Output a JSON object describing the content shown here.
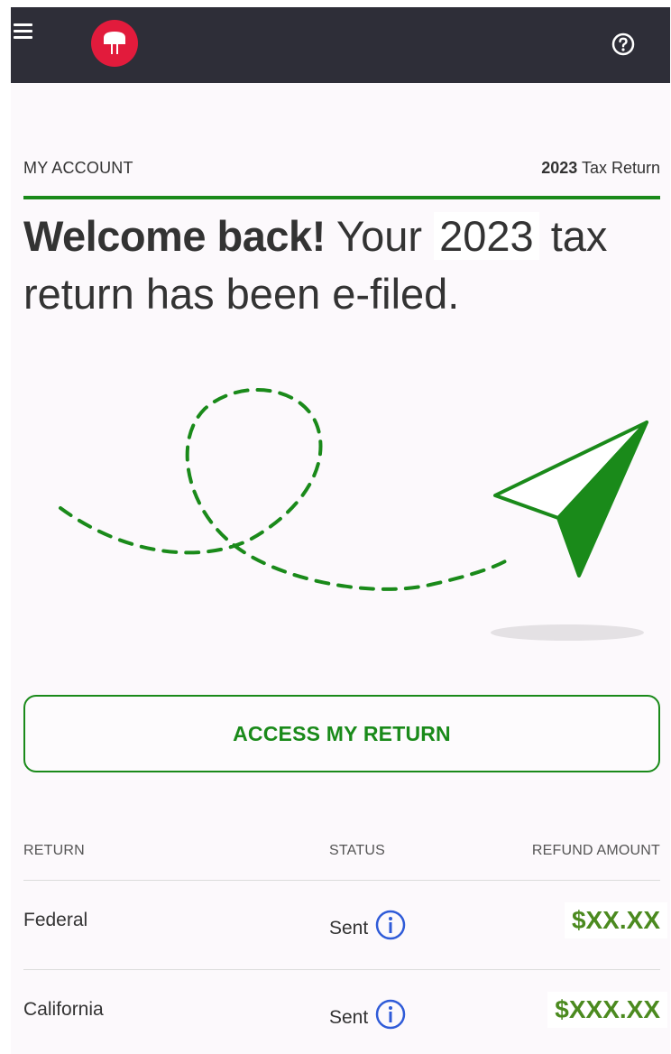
{
  "header": {
    "menu_icon": "hamburger-menu-icon",
    "logo_icon": "helmet-logo-icon",
    "help_icon": "question-circle-icon"
  },
  "account": {
    "label": "MY ACCOUNT",
    "tax_year": "2023",
    "tax_label": "Tax Return"
  },
  "headline": {
    "welcome": "Welcome back!",
    "your": "Your",
    "year": "2023",
    "rest_line1": "tax",
    "rest_line2": "return has been e-filed."
  },
  "actions": {
    "access_label": "ACCESS MY RETURN"
  },
  "returns_table": {
    "columns": [
      "RETURN",
      "STATUS",
      "REFUND AMOUNT"
    ],
    "rows": [
      {
        "name": "Federal",
        "status": "Sent",
        "amount": "$XX.XX"
      },
      {
        "name": "California",
        "status": "Sent",
        "amount": "$XXX.XX"
      }
    ]
  },
  "colors": {
    "brand_red": "#e21b3c",
    "accent_green": "#1a8a1a",
    "amount_green": "#4b8a1f",
    "topbar": "#2e2e38",
    "info_blue": "#2f5bd8"
  }
}
